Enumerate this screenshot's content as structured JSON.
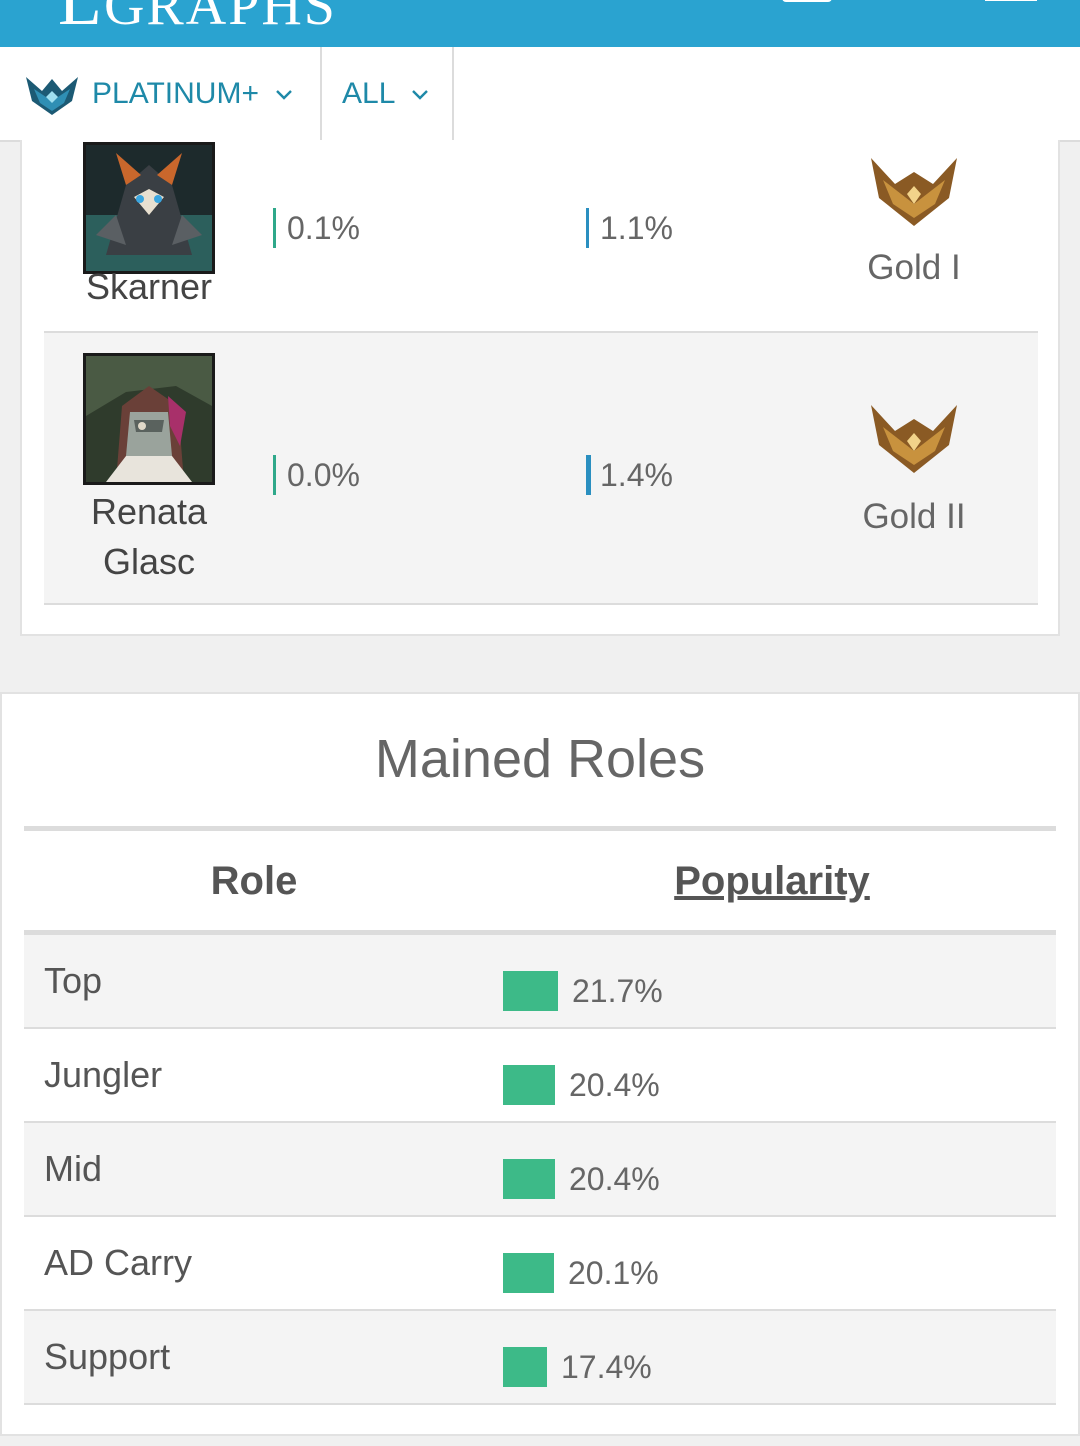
{
  "header": {
    "logo_initial": "L",
    "logo_text": "GRAPHS"
  },
  "filters": {
    "tier": "PLATINUM+",
    "scope": "ALL"
  },
  "champions": [
    {
      "name": "Skarner",
      "stat_1": "0.1%",
      "stat_2": "1.1%",
      "rank": "Gold I"
    },
    {
      "name": "Renata Glasc",
      "stat_1": "0.0%",
      "stat_2": "1.4%",
      "rank": "Gold II"
    }
  ],
  "mained_roles": {
    "title": "Mained Roles",
    "col_role": "Role",
    "col_popularity": "Popularity",
    "rows": [
      {
        "role": "Top",
        "popularity": "21.7%",
        "value": 21.7
      },
      {
        "role": "Jungler",
        "popularity": "20.4%",
        "value": 20.4
      },
      {
        "role": "Mid",
        "popularity": "20.4%",
        "value": 20.4
      },
      {
        "role": "AD Carry",
        "popularity": "20.1%",
        "value": 20.1
      },
      {
        "role": "Support",
        "popularity": "17.4%",
        "value": 17.4
      }
    ]
  },
  "colors": {
    "header_blue": "#2aa3d0",
    "accent_teal": "#1e89a8",
    "popularity_bar": "#3dba88",
    "stat_bar_1": "#2fa88a",
    "stat_bar_2": "#2a8fc0"
  },
  "icons": [
    "platinum-emblem-icon",
    "chevron-down-icon",
    "gold-emblem-icon"
  ]
}
